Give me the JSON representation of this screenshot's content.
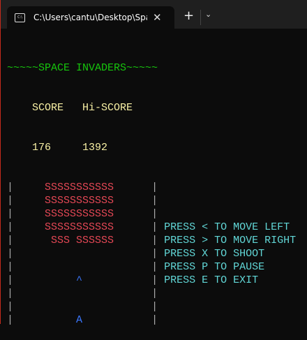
{
  "window": {
    "tab_title": "C:\\Users\\cantu\\Desktop\\Spac",
    "tab_icon": "terminal-icon",
    "close_label": "✕",
    "new_tab_label": "+",
    "dropdown_label": "⌄"
  },
  "game": {
    "title": "~~~~~SPACE INVADERS~~~~~",
    "score_label": "SCORE",
    "hiscore_label": "Hi-SCORE",
    "score": "176",
    "hiscore": "1392",
    "border_char": "|",
    "rows": [
      {
        "field": "     SSSSSSSSSSS     ",
        "help": ""
      },
      {
        "field": "     SSSSSSSSSSS     ",
        "help": ""
      },
      {
        "field": "     SSSSSSSSSSS     ",
        "help": ""
      },
      {
        "field": "     SSSSSSSSSSS     ",
        "help": "PRESS < TO MOVE LEFT"
      },
      {
        "field": "      SSS SSSSSS     ",
        "help": "PRESS > TO MOVE RIGHT"
      },
      {
        "field": "                     ",
        "help": "PRESS X TO SHOOT"
      },
      {
        "field": "                     ",
        "help": "PRESS P TO PAUSE"
      },
      {
        "field": "          ^          ",
        "help": "PRESS E TO EXIT"
      },
      {
        "field": "                     ",
        "help": ""
      },
      {
        "field": "                     ",
        "help": ""
      },
      {
        "field": "          A          ",
        "help": ""
      }
    ]
  },
  "colors": {
    "title": "#16c60c",
    "score": "#f9f1a5",
    "invaders": "#e74856",
    "help": "#61d6d6",
    "player": "#3b78ff"
  }
}
